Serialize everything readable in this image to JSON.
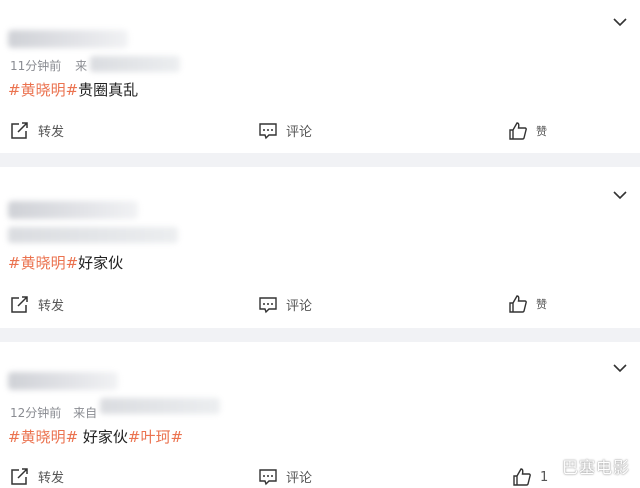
{
  "posts": [
    {
      "time": "11分钟前",
      "source_partial": "来",
      "tags": [
        "#黄晓明#"
      ],
      "text_after": "贵圈真乱",
      "tags2": [],
      "actions": {
        "repost": "转发",
        "comment": "评论",
        "like": "赞",
        "like_count": ""
      }
    },
    {
      "time": "",
      "source_partial": "",
      "tags": [
        "#黄晓明#"
      ],
      "text_after": "好家伙",
      "tags2": [],
      "actions": {
        "repost": "转发",
        "comment": "评论",
        "like": "赞",
        "like_count": ""
      }
    },
    {
      "time": "12分钟前",
      "source_partial": "来自",
      "tags": [
        "#黄晓明#"
      ],
      "text_after": " 好家伙",
      "tags2": [
        "#叶珂#"
      ],
      "actions": {
        "repost": "转发",
        "comment": "评论",
        "like": "",
        "like_count": "1"
      }
    }
  ],
  "watermark": "巴塞电影",
  "colors": {
    "tag": "#eb7350",
    "bg": "#f1f2f5",
    "card": "#ffffff"
  }
}
